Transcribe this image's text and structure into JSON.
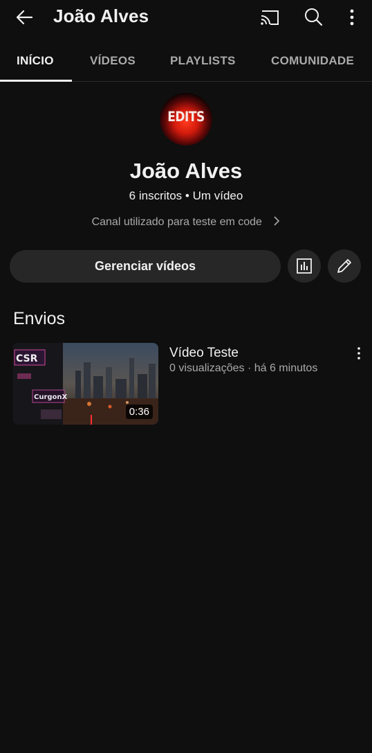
{
  "appbar": {
    "back_icon": "arrow-left-icon",
    "title": "João Alves",
    "cast_icon": "cast-icon",
    "search_icon": "search-icon",
    "more_icon": "more-vertical-icon"
  },
  "tabs": [
    {
      "label": "INÍCIO",
      "active": true
    },
    {
      "label": "VÍDEOS",
      "active": false
    },
    {
      "label": "PLAYLISTS",
      "active": false
    },
    {
      "label": "COMUNIDADE",
      "active": false
    }
  ],
  "channel": {
    "avatar_text": "EDITS",
    "name": "João Alves",
    "stats": "6 inscritos • Um vídeo",
    "description": "Canal utilizado para teste em code"
  },
  "actions": {
    "manage_label": "Gerenciar vídeos",
    "analytics_icon": "analytics-icon",
    "edit_icon": "pencil-icon"
  },
  "uploads": {
    "section_title": "Envios",
    "videos": [
      {
        "title": "Vídeo Teste",
        "meta": "0 visualizações · há 6 minutos",
        "duration": "0:36",
        "thumb_sign_1": "CSR",
        "thumb_sign_2": "CurgonX"
      }
    ]
  },
  "colors": {
    "background": "#0f0f0f",
    "surface": "#272727",
    "text_primary": "#f1f1f1",
    "text_secondary": "#aaaaaa"
  }
}
